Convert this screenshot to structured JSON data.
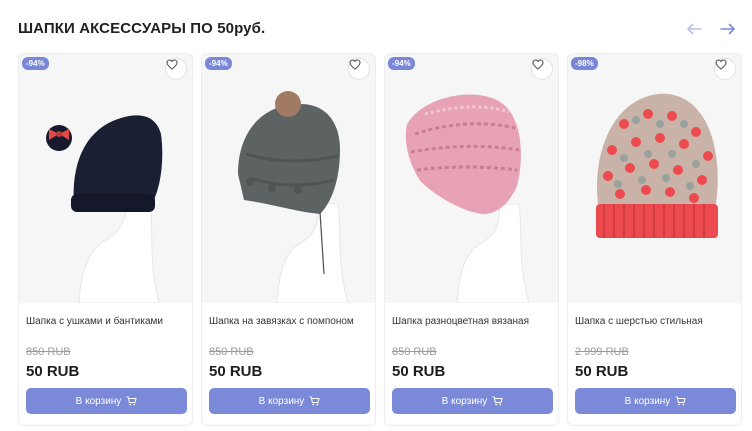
{
  "section": {
    "title": "ШАПКИ АКСЕССУАРЫ ПО 50руб.",
    "prev_icon": "arrow-left-icon",
    "next_icon": "arrow-right-icon"
  },
  "colors": {
    "accent": "#7b89d9",
    "badge": "#7a87d8",
    "arrow_prev": "#b8c0ea",
    "arrow_next": "#7b89d9"
  },
  "products": [
    {
      "badge": "-94%",
      "name": "Шапка с ушками и бантиками",
      "old_price": "850 RUB",
      "price": "50 RUB",
      "button_label": "В корзину",
      "hat_color": "#1b1f33",
      "accent_color": "#e24a4a"
    },
    {
      "badge": "-94%",
      "name": "Шапка на завязках с помпоном",
      "old_price": "850 RUB",
      "price": "50 RUB",
      "button_label": "В корзину",
      "hat_color": "#5d6362",
      "accent_color": "#a07a62"
    },
    {
      "badge": "-94%",
      "name": "Шапка разноцветная вязаная",
      "old_price": "850 RUB",
      "price": "50 RUB",
      "button_label": "В корзину",
      "hat_color": "#e8a2b6",
      "accent_color": "#c77e8f"
    },
    {
      "badge": "-98%",
      "name": "Шапка с шерстью стильная",
      "old_price": "2 999 RUB",
      "price": "50 RUB",
      "button_label": "В корзину",
      "hat_color": "#c9b3a8",
      "accent_color": "#ec4a4e"
    }
  ]
}
